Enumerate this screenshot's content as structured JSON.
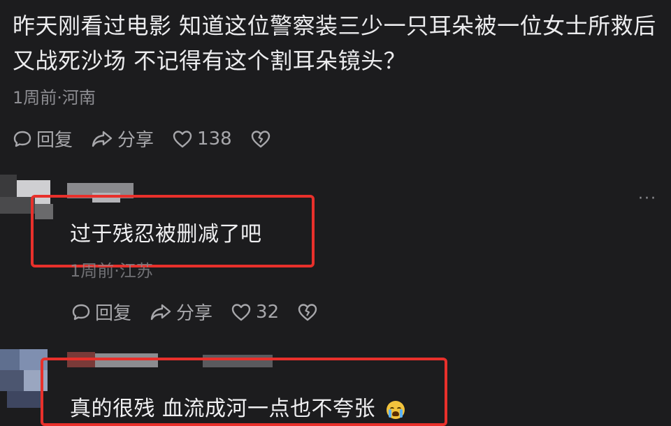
{
  "comment_main": {
    "text": "昨天刚看过电影 知道这位警察装三少一只耳朵被一位女士所救后又战死沙场 不记得有这个割耳朵镜头？",
    "meta": "1周前·河南",
    "reply_label": "回复",
    "share_label": "分享",
    "like_count": "138"
  },
  "reply_1": {
    "text": "过于残忍被删减了吧",
    "meta": "1周前·江苏",
    "reply_label": "回复",
    "share_label": "分享",
    "like_count": "32"
  },
  "reply_2": {
    "text": "真的很残 血流成河一点也不夸张"
  },
  "icons": {
    "comment": "comment-bubble-icon",
    "share": "share-arrow-icon",
    "like": "heart-icon",
    "dislike": "broken-heart-icon",
    "more": "more-dots-icon",
    "emoji": "crying-face-emoji"
  },
  "colors": {
    "background": "#1c1c1e",
    "text": "#e9e9ea",
    "meta": "#8e8e93",
    "highlight_box": "#e8302b"
  }
}
